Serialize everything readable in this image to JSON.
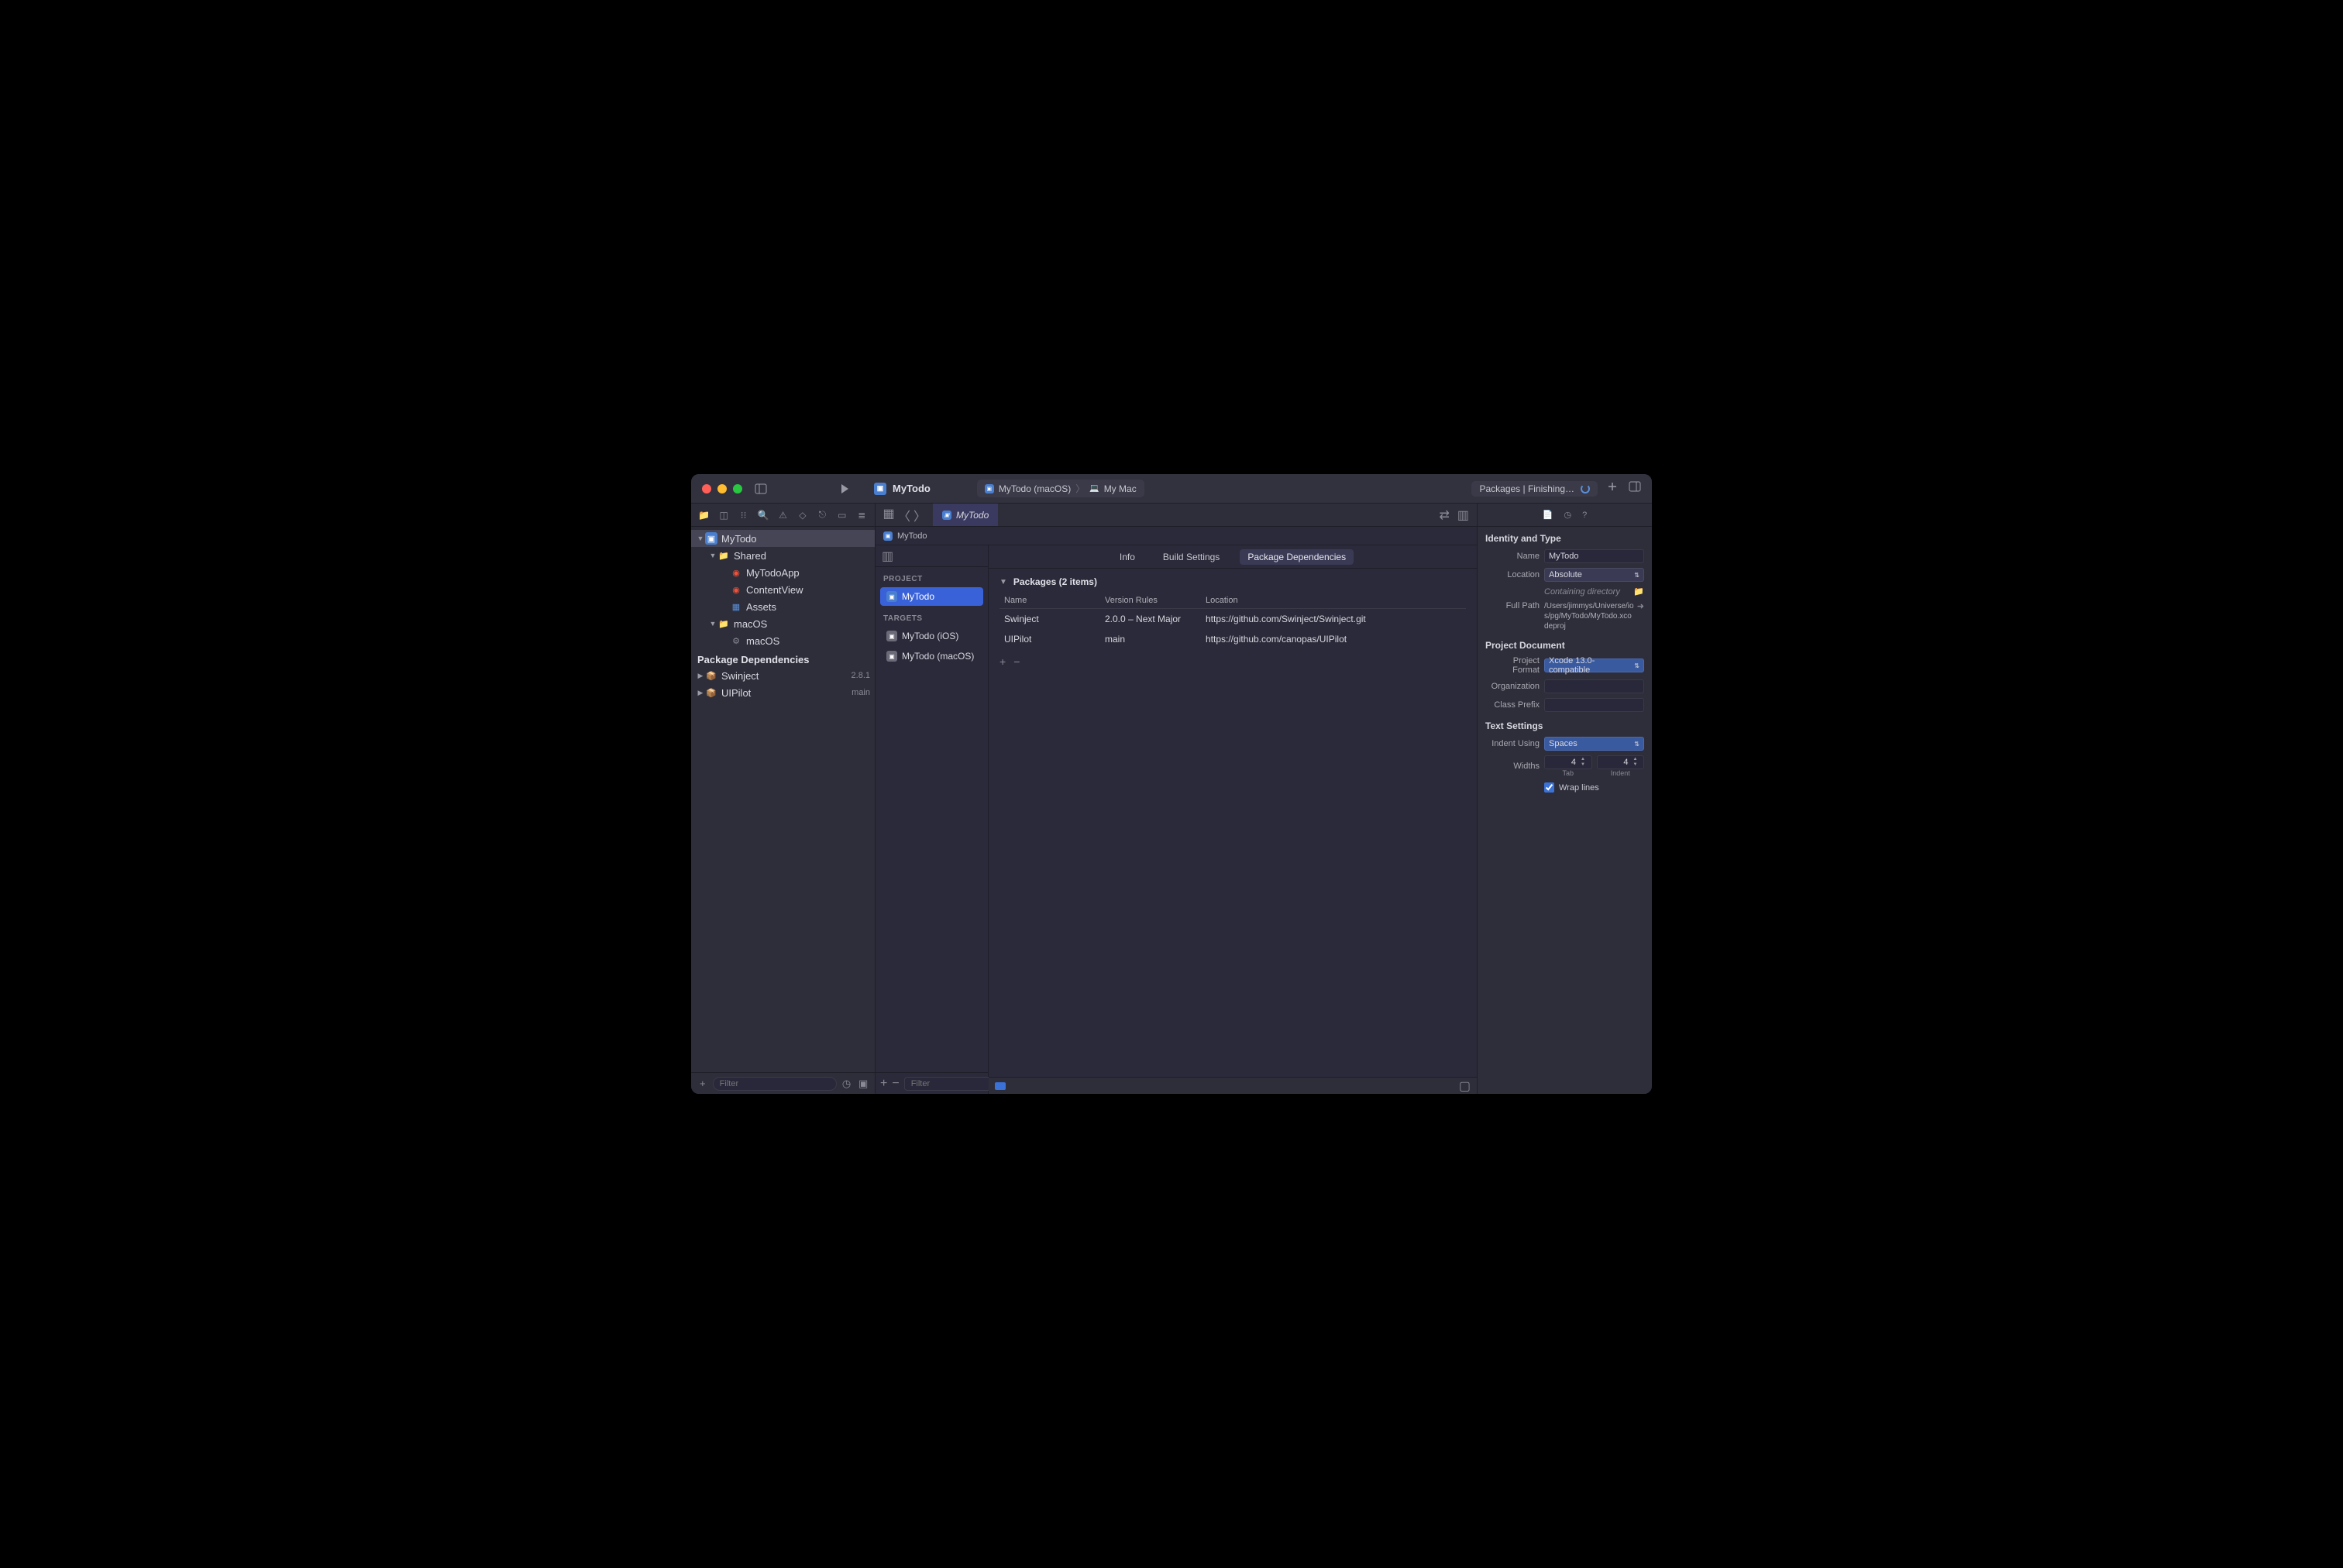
{
  "titlebar": {
    "project": "MyTodo",
    "scheme": "MyTodo (macOS)",
    "destination": "My Mac",
    "status": "Packages | Finishing…"
  },
  "navigator": {
    "root": "MyTodo",
    "shared": {
      "label": "Shared",
      "children": [
        "MyTodoApp",
        "ContentView",
        "Assets"
      ]
    },
    "macos": {
      "label": "macOS",
      "children": [
        "macOS"
      ]
    },
    "deps_header": "Package Dependencies",
    "deps": [
      {
        "name": "Swinject",
        "version": "2.8.1"
      },
      {
        "name": "UIPilot",
        "version": "main"
      }
    ],
    "filter_placeholder": "Filter"
  },
  "center": {
    "tab": "MyTodo",
    "breadcrumb": "MyTodo",
    "project_section": "PROJECT",
    "project_item": "MyTodo",
    "targets_section": "TARGETS",
    "targets": [
      "MyTodo (iOS)",
      "MyTodo (macOS)"
    ],
    "filter_placeholder": "Filter",
    "segments": {
      "info": "Info",
      "build": "Build Settings",
      "pkg": "Package Dependencies"
    },
    "packages_header": "Packages (2 items)",
    "columns": {
      "name": "Name",
      "rules": "Version Rules",
      "location": "Location"
    },
    "rows": [
      {
        "name": "Swinject",
        "rules": "2.0.0 – Next Major",
        "location": "https://github.com/Swinject/Swinject.git"
      },
      {
        "name": "UIPilot",
        "rules": "main",
        "location": "https://github.com/canopas/UIPilot"
      }
    ]
  },
  "inspector": {
    "identity_header": "Identity and Type",
    "name_label": "Name",
    "name_value": "MyTodo",
    "location_label": "Location",
    "location_value": "Absolute",
    "containing": "Containing directory",
    "fullpath_label": "Full Path",
    "fullpath_value": "/Users/jimmys/Universe/ios/pg/MyTodo/MyTodo.xcodeproj",
    "project_doc_header": "Project Document",
    "format_label": "Project Format",
    "format_value": "Xcode 13.0-compatible",
    "org_label": "Organization",
    "org_value": "",
    "prefix_label": "Class Prefix",
    "prefix_value": "",
    "text_header": "Text Settings",
    "indent_label": "Indent Using",
    "indent_value": "Spaces",
    "widths_label": "Widths",
    "tab_value": "4",
    "indent_width_value": "4",
    "tab_sublabel": "Tab",
    "indent_sublabel": "Indent",
    "wrap_label": "Wrap lines"
  }
}
